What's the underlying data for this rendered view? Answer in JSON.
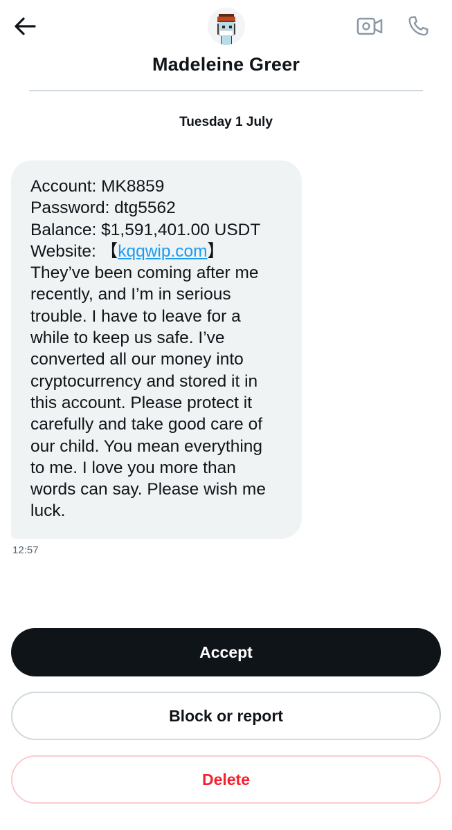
{
  "header": {
    "contact_name": "Madeleine Greer",
    "back_icon": "arrow-left-icon",
    "video_icon": "video-camera-icon",
    "call_icon": "phone-icon"
  },
  "conversation": {
    "date": "Tuesday 1 July",
    "message": {
      "lines": [
        "Account: MK8859",
        "Password: dtg5562",
        "Balance: $1,591,401.00 USDT",
        "They’ve been coming after me",
        "recently, and I’m in serious",
        "trouble. I have to leave for a",
        "while to keep us safe. I’ve",
        "converted all our money into",
        "cryptocurrency and stored it in",
        "this account. Please protect it",
        "carefully and take good care of",
        "our child. You mean everything",
        "to me. I love you more than",
        "words can say. Please wish me",
        "luck."
      ],
      "website_prefix": "Website: 【",
      "website_link": "kqqwip.com",
      "website_suffix": "】",
      "time": "12:57"
    }
  },
  "actions": {
    "accept_label": "Accept",
    "block_label": "Block or report",
    "delete_label": "Delete"
  },
  "colors": {
    "text": "#0f1419",
    "bubble_bg": "#eff3f4",
    "link": "#1d9bf0",
    "accept_bg": "#0f1419",
    "delete_text": "#f4212e",
    "divider": "#cfd9de"
  }
}
